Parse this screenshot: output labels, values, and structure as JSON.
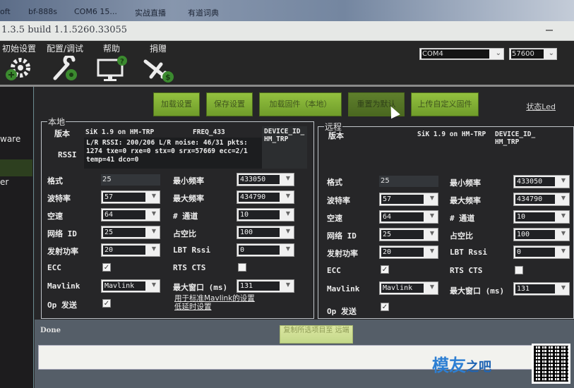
{
  "taskbar": {
    "items": [
      "oft",
      "bf-888s",
      "COM6 15...",
      "实战直播",
      "有道词典"
    ]
  },
  "window": {
    "title": "1.3.5 build 1.1.5260.33055"
  },
  "menu": {
    "items": [
      {
        "label": "初始设置",
        "icon": "gear-plus-icon"
      },
      {
        "label": "配置/调试",
        "icon": "wrench-gear-icon"
      },
      {
        "label": "帮助",
        "icon": "monitor-help-icon"
      },
      {
        "label": "捐赠",
        "icon": "plane-dollar-icon"
      }
    ],
    "port": "COM4",
    "baud": "57600"
  },
  "sidebar": {
    "items": [
      "ware",
      "er"
    ]
  },
  "toolbar": {
    "buttons": [
      "加载设置",
      "保存设置",
      "加载固件（本地）",
      "重置为默认",
      "上传自定义固件"
    ],
    "status_led": "状态Led"
  },
  "local": {
    "legend": "本地",
    "version_label": "版本",
    "version": "SiK 1.9 on HM-TRP",
    "freq": "FREQ_433",
    "device_id": "DEVICE_ID_ HM_TRP",
    "rssi_label": "RSSI",
    "rssi_lines": [
      "L/R RSSI: 200/206  L/R noise: 46/31 pkts:",
      "1274  txe=0 rxe=0 stx=0 srx=57669 ecc=2/1",
      "temp=41 dco=0"
    ],
    "fields": {
      "format": {
        "label": "格式",
        "value": "25"
      },
      "baud": {
        "label": "波特率",
        "value": "57"
      },
      "air_speed": {
        "label": "空速",
        "value": "64"
      },
      "net_id": {
        "label": "网络 ID",
        "value": "25"
      },
      "tx_power": {
        "label": "发射功率",
        "value": "20"
      },
      "ecc": {
        "label": "ECC",
        "checked": true
      },
      "mavlink": {
        "label": "Mavlink",
        "value": "Mavlink"
      },
      "op_send": {
        "label": "Op 发送",
        "checked": true
      },
      "min_freq": {
        "label": "最小频率",
        "value": "433050"
      },
      "max_freq": {
        "label": "最大频率",
        "value": "434790"
      },
      "channels": {
        "label": "# 通道",
        "value": "10"
      },
      "duty": {
        "label": "占空比",
        "value": "100"
      },
      "lbt_rssi": {
        "label": "LBT Rssi",
        "value": "0"
      },
      "rts_cts": {
        "label": "RTS CTS",
        "checked": false
      },
      "max_window": {
        "label": "最大窗口 (ms)",
        "value": "131"
      }
    },
    "links": [
      "用于标准Mavlink的设置",
      "低延时设置"
    ]
  },
  "remote": {
    "legend": "远程",
    "version_label": "版本",
    "version": "SiK 1.9 on HM-TRP",
    "device_id": "DEVICE_ID_ HM_TRP",
    "fields": {
      "format": {
        "label": "格式",
        "value": "25"
      },
      "baud": {
        "label": "波特率",
        "value": "57"
      },
      "air_speed": {
        "label": "空速",
        "value": "64"
      },
      "net_id": {
        "label": "网络 ID",
        "value": "25"
      },
      "tx_power": {
        "label": "发射功率",
        "value": "20"
      },
      "ecc": {
        "label": "ECC",
        "checked": true
      },
      "mavlink": {
        "label": "Mavlink",
        "value": "Mavlink"
      },
      "op_send": {
        "label": "Op 发送",
        "checked": true
      },
      "min_freq": {
        "label": "最小频率",
        "value": "433050"
      },
      "max_freq": {
        "label": "最大频率",
        "value": "434790"
      },
      "channels": {
        "label": "# 通道",
        "value": "10"
      },
      "duty": {
        "label": "占空比",
        "value": "100"
      },
      "lbt_rssi": {
        "label": "LBT Rssi",
        "value": "0"
      },
      "rts_cts": {
        "label": "RTS CTS",
        "checked": false
      },
      "max_window": {
        "label": "最大窗口 (ms)",
        "value": "131"
      }
    }
  },
  "footer": {
    "copy_button": "复制所选项目至 远端",
    "status": "Done",
    "progress": 0
  },
  "watermark": {
    "text": "模友",
    "suffix": "之吧",
    "url": "http://www.moz8.com"
  },
  "colors": {
    "button_green": "#7fab34",
    "panel_bg": "#262628",
    "brand_blue": "#2d7fd3"
  }
}
